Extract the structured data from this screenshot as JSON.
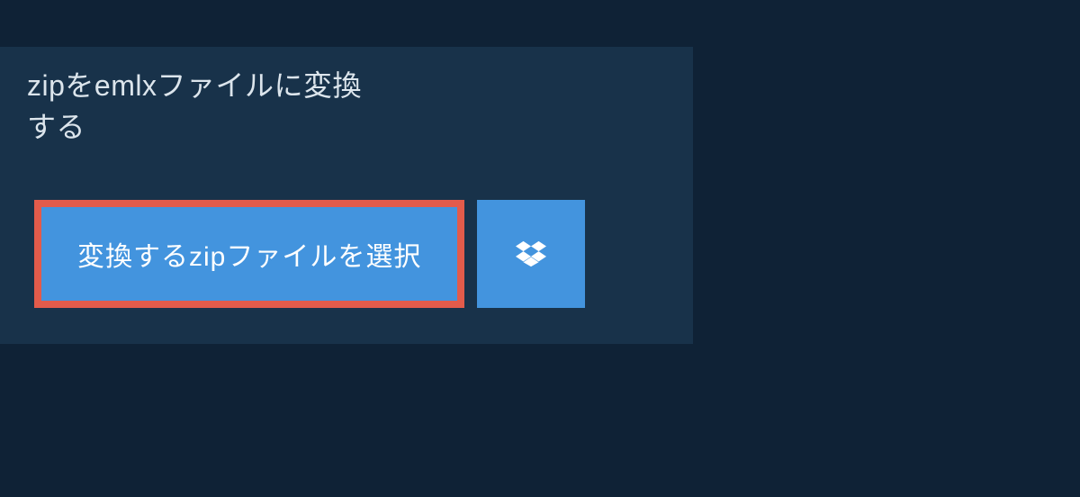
{
  "title": "zipをemlxファイルに変換する",
  "select_button_label": "変換するzipファイルを選択"
}
